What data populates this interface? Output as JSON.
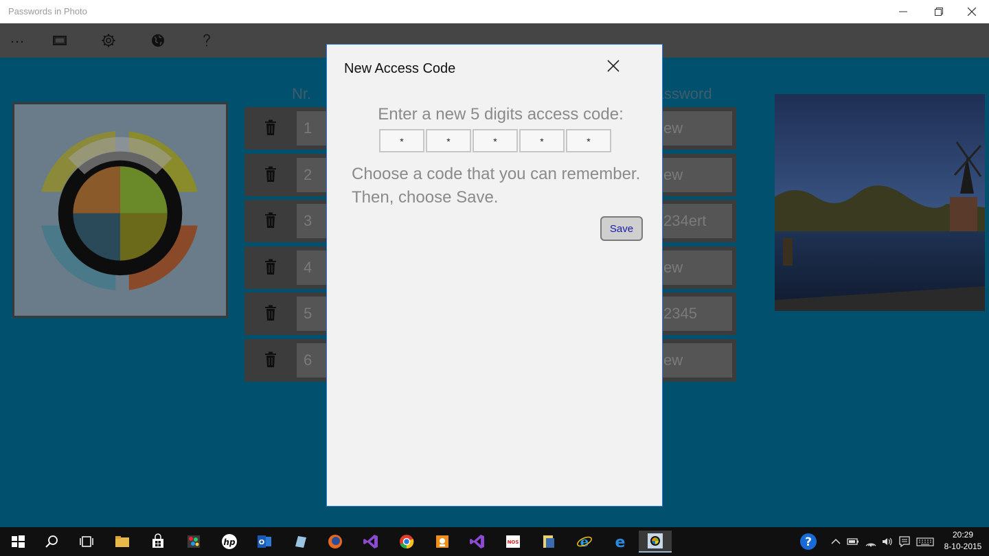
{
  "window": {
    "title": "Passwords in Photo"
  },
  "toolbar": {
    "items": [
      {
        "name": "more",
        "icon": "more-icon"
      },
      {
        "name": "photo",
        "icon": "photo-stack-icon"
      },
      {
        "name": "settings",
        "icon": "gear-icon"
      },
      {
        "name": "language",
        "icon": "globe-icon"
      },
      {
        "name": "help",
        "icon": "question-icon"
      }
    ]
  },
  "table": {
    "col_nr": "Nr.",
    "col_password": "Password",
    "rows": [
      {
        "nr": "1",
        "password": "ew"
      },
      {
        "nr": "2",
        "password": "ew"
      },
      {
        "nr": "3",
        "password": "234ert"
      },
      {
        "nr": "4",
        "password": "ew"
      },
      {
        "nr": "5",
        "password": "2345"
      },
      {
        "nr": "6",
        "password": "ew"
      }
    ]
  },
  "dialog": {
    "title": "New Access Code",
    "prompt": "Enter a new 5 digits access code:",
    "digits": [
      "*",
      "*",
      "*",
      "*",
      "*"
    ],
    "hint_line1": "Choose a code that you can remember.",
    "hint_line2": "Then, choose Save.",
    "save_label": "Save"
  },
  "taskbar": {
    "time": "20:29",
    "date": "8-10-2015"
  },
  "colors": {
    "accent": "#2b7bd6",
    "background": "#00506e",
    "toolbar": "#454545"
  }
}
